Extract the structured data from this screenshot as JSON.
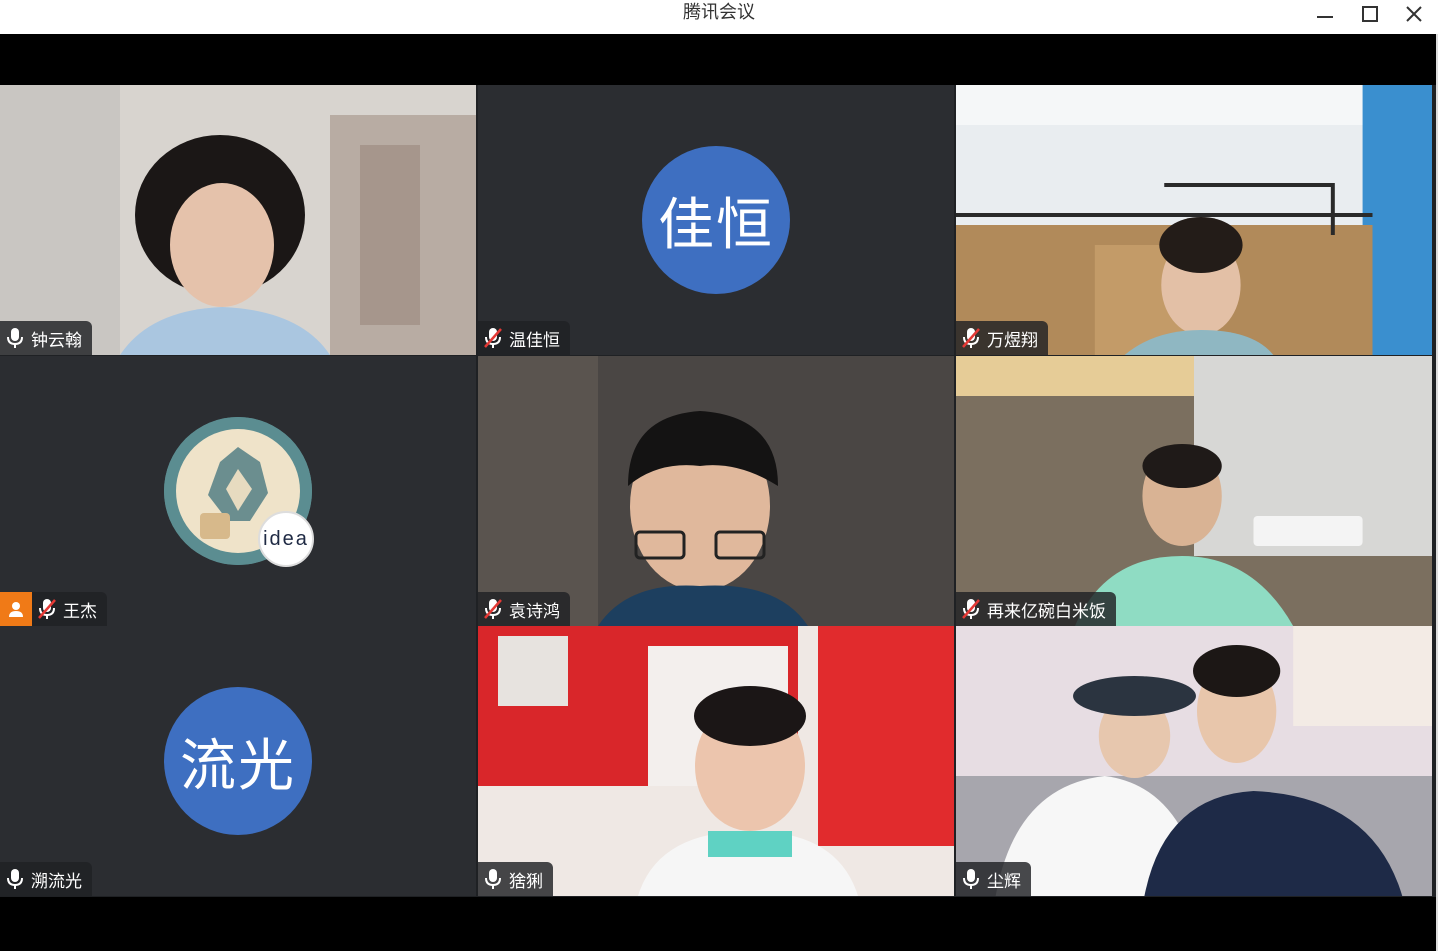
{
  "window": {
    "title": "腾讯会议"
  },
  "colors": {
    "avatar_blue": "#3e6fc1",
    "host_badge": "#f07a17",
    "tile_bg": "#2b2d31"
  },
  "participants": [
    {
      "name": "钟云翰",
      "mic": "on"
    },
    {
      "name": "温佳恒",
      "mic": "muted",
      "avatar_text": "佳恒"
    },
    {
      "name": "万煜翔",
      "mic": "muted"
    },
    {
      "name": "王杰",
      "mic": "muted",
      "host": true,
      "avatar_badge": "idea"
    },
    {
      "name": "袁诗鸿",
      "mic": "muted"
    },
    {
      "name": "再来亿碗白米饭",
      "mic": "muted"
    },
    {
      "name": "溯流光",
      "mic": "on",
      "avatar_text": "流光"
    },
    {
      "name": "猞猁",
      "mic": "on"
    },
    {
      "name": "尘辉",
      "mic": "on"
    }
  ]
}
